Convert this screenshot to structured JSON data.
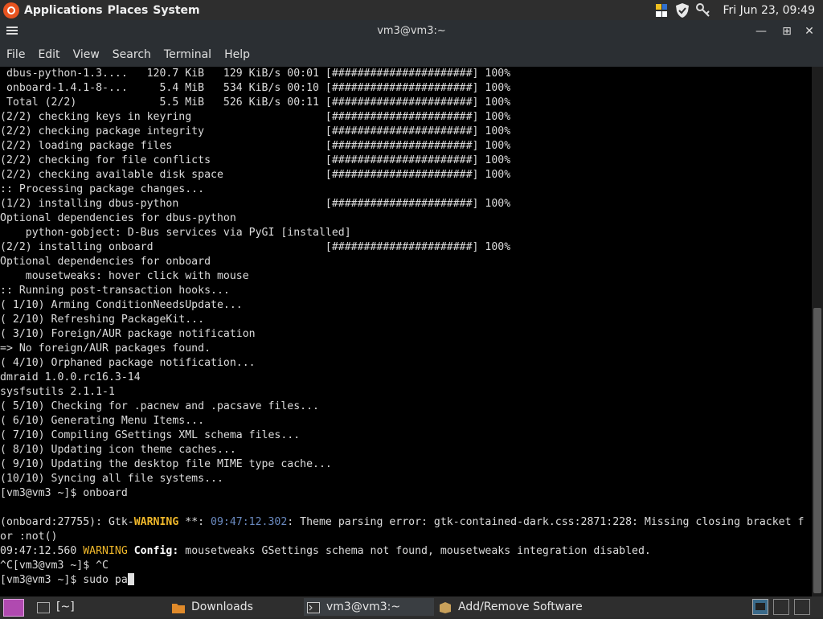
{
  "top_panel": {
    "menus": [
      "Applications",
      "Places",
      "System"
    ],
    "clock": "Fri Jun 23, 09:49"
  },
  "window": {
    "title": "vm3@vm3:~",
    "menu": [
      "File",
      "Edit",
      "View",
      "Search",
      "Terminal",
      "Help"
    ]
  },
  "terminal": {
    "lines": [
      " dbus-python-1.3....   120.7 KiB   129 KiB/s 00:01 [######################] 100%",
      " onboard-1.4.1-8-...     5.4 MiB   534 KiB/s 00:10 [######################] 100%",
      " Total (2/2)             5.5 MiB   526 KiB/s 00:11 [######################] 100%",
      "(2/2) checking keys in keyring                     [######################] 100%",
      "(2/2) checking package integrity                   [######################] 100%",
      "(2/2) loading package files                        [######################] 100%",
      "(2/2) checking for file conflicts                  [######################] 100%",
      "(2/2) checking available disk space                [######################] 100%",
      ":: Processing package changes...",
      "(1/2) installing dbus-python                       [######################] 100%",
      "Optional dependencies for dbus-python",
      "    python-gobject: D-Bus services via PyGI [installed]",
      "(2/2) installing onboard                           [######################] 100%",
      "Optional dependencies for onboard",
      "    mousetweaks: hover click with mouse",
      ":: Running post-transaction hooks...",
      "( 1/10) Arming ConditionNeedsUpdate...",
      "( 2/10) Refreshing PackageKit...",
      "( 3/10) Foreign/AUR package notification",
      "=> No foreign/AUR packages found.",
      "( 4/10) Orphaned package notification...",
      "dmraid 1.0.0.rc16.3-14",
      "sysfsutils 2.1.1-1",
      "( 5/10) Checking for .pacnew and .pacsave files...",
      "( 6/10) Generating Menu Items...",
      "( 7/10) Compiling GSettings XML schema files...",
      "( 8/10) Updating icon theme caches...",
      "( 9/10) Updating the desktop file MIME type cache...",
      "(10/10) Syncing all file systems...",
      "[vm3@vm3 ~]$ onboard",
      ""
    ],
    "warn1_prefix": "(onboard:27755): Gtk-",
    "warn1_word": "WARNING",
    "warn1_stars": " **: ",
    "warn1_time": "09:47:12.302",
    "warn1_msg": ": Theme parsing error: gtk-contained-dark.css:2871:228: Missing closing bracket f",
    "warn1_cont": "or :not()",
    "warn2_time": "09:47:12.560 ",
    "warn2_word": "WARNING",
    "warn2_cfg": " Config:",
    "warn2_msg": " mousetweaks GSettings schema not found, mousetweaks integration disabled.",
    "ctrl_c_line": "^C[vm3@vm3 ~]$ ^C",
    "prompt": "[vm3@vm3 ~]$ sudo pa"
  },
  "taskbar": {
    "tasks": [
      "[~]",
      "Downloads",
      "vm3@vm3:~",
      "Add/Remove Software"
    ]
  },
  "colors": {
    "warning": "#f0b82b",
    "timestamp": "#6a8ac0",
    "panel": "#2e2e2e"
  }
}
